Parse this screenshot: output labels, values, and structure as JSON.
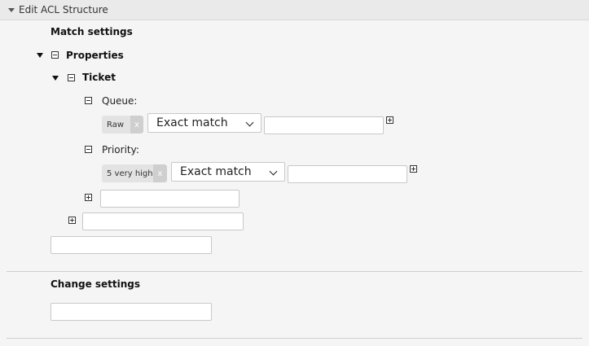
{
  "header": {
    "title": "Edit ACL Structure"
  },
  "match": {
    "heading": "Match settings",
    "properties_label": "Properties",
    "ticket_label": "Ticket",
    "fields": [
      {
        "label": "Queue:",
        "tag": "Raw",
        "tag_remove": "x",
        "mode": "Exact match",
        "value": ""
      },
      {
        "label": "Priority:",
        "tag": "5 very high",
        "tag_remove": "x",
        "mode": "Exact match",
        "value": ""
      }
    ]
  },
  "change": {
    "heading": "Change settings"
  }
}
